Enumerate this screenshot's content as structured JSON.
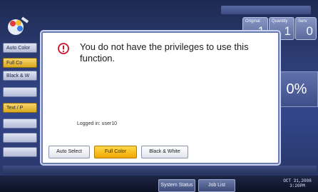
{
  "header": {
    "counters": [
      {
        "label": "Original",
        "value": "1"
      },
      {
        "label": "Quantity",
        "value": "1"
      },
      {
        "label": "Serv",
        "value": "0"
      }
    ]
  },
  "background": {
    "left_buttons": [
      "Auto Color",
      "Full Co",
      "Black & W",
      "Text / P"
    ],
    "right_panel_value": "0%"
  },
  "dialog": {
    "message": "You do not have the privileges to use this function.",
    "logged_in": "Logged in: user10",
    "buttons": [
      {
        "label": "Auto Select",
        "selected": false
      },
      {
        "label": "Full Color",
        "selected": true
      },
      {
        "label": "Black & White",
        "selected": false
      }
    ]
  },
  "taskbar": {
    "system_status": "System Status",
    "job_list": "Job List",
    "date": "OCT 31,2008",
    "time": "3:20PM"
  },
  "colors": {
    "accent": "#f0a800",
    "alert_icon": "#c8102e",
    "screen_bg": "#2c3c73"
  }
}
